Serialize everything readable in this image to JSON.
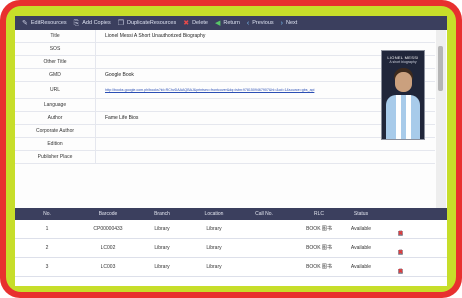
{
  "toolbar": {
    "buttons": [
      {
        "label": "EditResources",
        "icon": "edit-icon"
      },
      {
        "label": "Add Copies",
        "icon": "copy-icon"
      },
      {
        "label": "DuplicateResources",
        "icon": "duplicate-icon"
      },
      {
        "label": "Delete",
        "icon": "delete-icon"
      },
      {
        "label": "Return",
        "icon": "return-icon"
      },
      {
        "label": "Previous",
        "icon": "previous-icon"
      },
      {
        "label": "Next",
        "icon": "next-icon"
      }
    ]
  },
  "detail": {
    "fields": [
      {
        "label": "Title",
        "value": "Lionel Messi A Short Unauthorized Biography"
      },
      {
        "label": "SOS",
        "value": ""
      },
      {
        "label": "Other Title",
        "value": ""
      },
      {
        "label": "GMD",
        "value": "Google Book"
      },
      {
        "label": "URL",
        "value": "http://books.google.com.ph/books?id=RChvDAAAQBAJ&printsec=frontcover&dq=isbn:9781509467907&hl=&cd=1&source=gbs_api"
      },
      {
        "label": "Language",
        "value": ""
      },
      {
        "label": "Author",
        "value": "Fame Life Bios"
      },
      {
        "label": "Corporate Author",
        "value": ""
      },
      {
        "label": "Edition",
        "value": ""
      },
      {
        "label": "Publisher Place",
        "value": ""
      }
    ],
    "cover": {
      "title": "LIONEL MESSI",
      "subtitle": "A short biography"
    }
  },
  "copies": {
    "headers": [
      "No.",
      "Barcode",
      "Branch",
      "Location",
      "Call No.",
      "RLC",
      "Status"
    ],
    "rows": [
      {
        "no": "1",
        "barcode": "CP00000433",
        "branch": "Library",
        "location": "Library",
        "call_no": "",
        "rlc": "BOOK 图书",
        "status": "Available"
      },
      {
        "no": "2",
        "barcode": "LC002",
        "branch": "Library",
        "location": "Library",
        "call_no": "",
        "rlc": "BOOK 图书",
        "status": "Available"
      },
      {
        "no": "3",
        "barcode": "LC003",
        "branch": "Library",
        "location": "Library",
        "call_no": "",
        "rlc": "BOOK 图书",
        "status": "Available"
      }
    ]
  },
  "colors": {
    "outer_frame": "#e8302f",
    "inner_frame": "#c7de2a",
    "header_bar": "#3b3f5e"
  }
}
